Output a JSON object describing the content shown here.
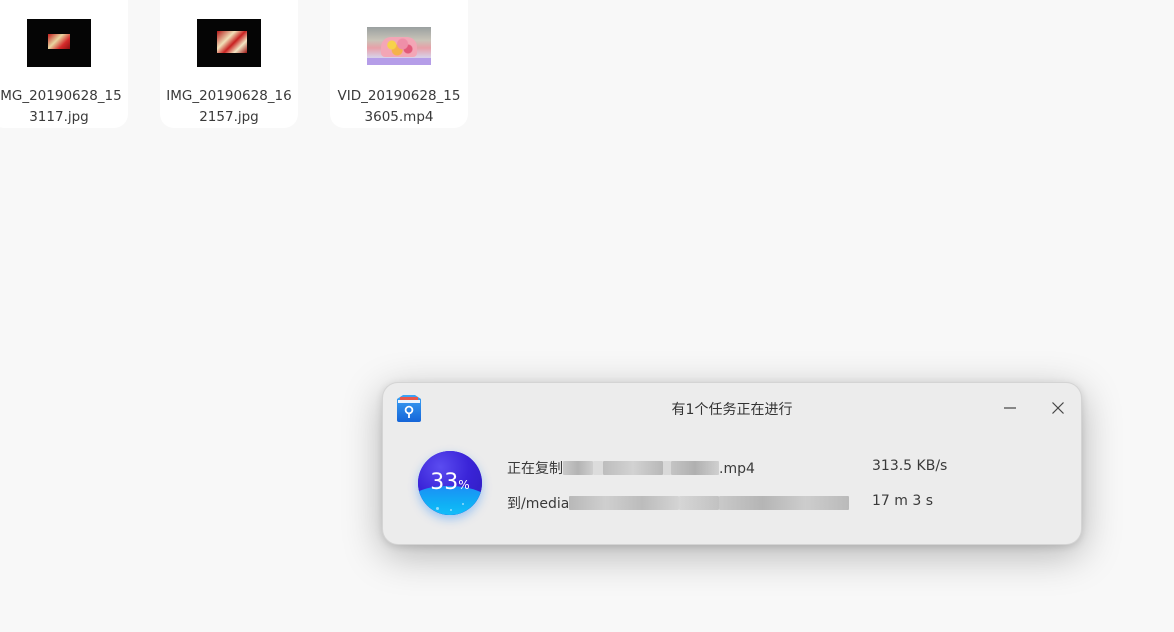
{
  "files": [
    {
      "name": "IMG_20190628_153117.jpg",
      "kind": "image"
    },
    {
      "name": "IMG_20190628_162157.jpg",
      "kind": "image"
    },
    {
      "name": "VID_20190628_153605.mp4",
      "kind": "video"
    }
  ],
  "dialog": {
    "title": "有1个任务正在进行",
    "app_icon": "file-manager-icon",
    "progress_percent": "33",
    "progress_symbol": "%",
    "progress_fraction": 0.33,
    "copy_prefix": "正在复制",
    "copy_suffix": ".mp4",
    "dest_prefix": "到/media",
    "speed": "313.5 KB/s",
    "eta": "17 m 3 s",
    "minimize_icon": "minimize-icon",
    "close_icon": "close-icon"
  },
  "colors": {
    "progress_top": "#3a24d8",
    "progress_water": "#0fb2f5",
    "app_icon_blue": "#1e88e5"
  }
}
